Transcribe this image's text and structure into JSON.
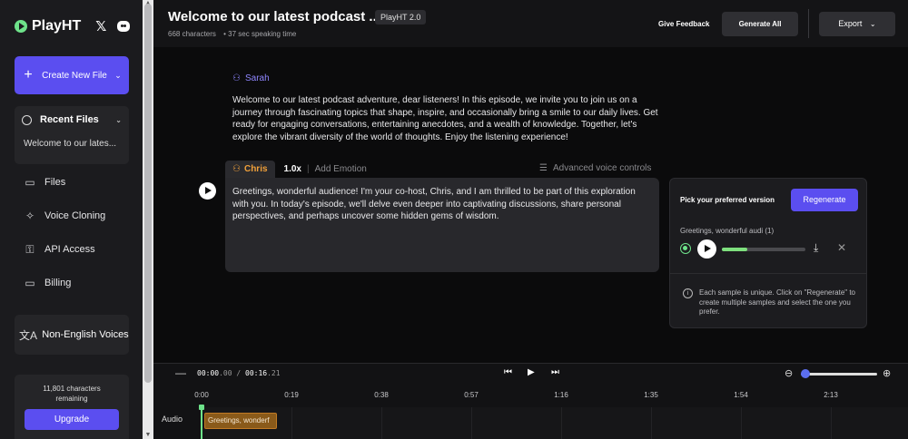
{
  "brand": {
    "name": "PlayHT",
    "accent": "#5b4ef0",
    "green": "#6ee28a"
  },
  "sidebar": {
    "social": [
      "x-icon",
      "discord-icon"
    ],
    "create_label": "Create New File",
    "recent_title": "Recent Files",
    "recent_item": "Welcome to our lates...",
    "nav": [
      {
        "label": "Files",
        "icon": "folder-icon"
      },
      {
        "label": "Voice Cloning",
        "icon": "sparkle-icon"
      },
      {
        "label": "API Access",
        "icon": "key-icon"
      },
      {
        "label": "Billing",
        "icon": "card-icon"
      }
    ],
    "non_english": "Non-English Voices",
    "credits_text": "11,801 characters remaining",
    "upgrade_label": "Upgrade"
  },
  "header": {
    "title": "Welcome to our latest podcast ...",
    "badge": "PlayHT 2.0",
    "characters": "668 characters",
    "speaking_time": "• 37 sec speaking time",
    "feedback_label": "Give Feedback",
    "generate_label": "Generate All",
    "export_label": "Export"
  },
  "editor": {
    "block1": {
      "speaker": "Sarah",
      "text": "Welcome to our latest podcast adventure, dear listeners! In this episode, we invite you to join us on a journey through fascinating topics that shape, inspire, and occasionally bring a smile to our daily lives. Get ready for engaging conversations, entertaining anecdotes, and a wealth of knowledge. Together, let's explore the vibrant diversity of the world of thoughts. Enjoy the listening experience!"
    },
    "block2": {
      "speaker": "Chris",
      "speed": "1.0x",
      "emotion_label": "Add Emotion",
      "advanced_label": "Advanced voice controls",
      "text": "Greetings, wonderful audience! I'm your co-host, Chris, and I am thrilled to be part of this exploration with you. In today's episode, we'll delve even deeper into captivating discussions, share personal perspectives, and perhaps uncover some hidden gems of wisdom."
    }
  },
  "panel": {
    "heading": "Pick your preferred version",
    "regenerate_label": "Regenerate",
    "sample_label": "Greetings, wonderful audi (1)",
    "progress": 0.3,
    "info_text": "Each sample is unique. Click on \"Regenerate\" to create multiple samples and select the one you prefer."
  },
  "timeline": {
    "current": "00:00",
    "current_ms": ".00",
    "separator": " / ",
    "total": "00:16",
    "total_ms": ".21",
    "zoom": 0.05,
    "ticks": [
      "0:00",
      "0:19",
      "0:38",
      "0:57",
      "1:16",
      "1:35",
      "1:54",
      "2:13"
    ],
    "track_label": "Audio",
    "clip_label": "Greetings, wonderf"
  }
}
